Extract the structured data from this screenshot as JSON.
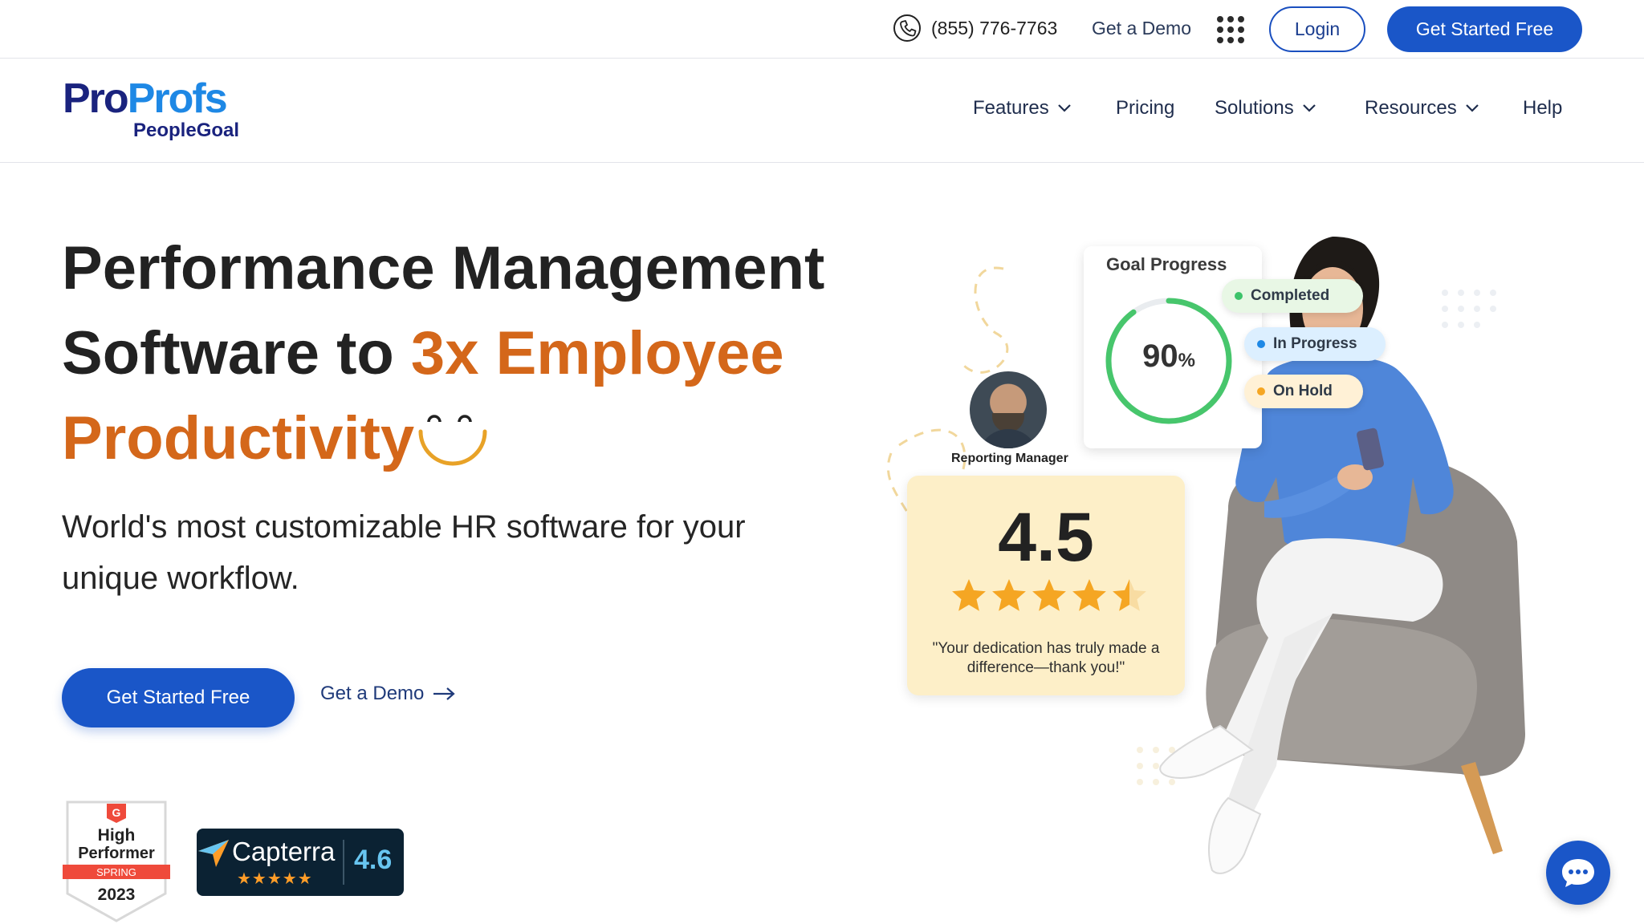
{
  "topbar": {
    "phone": "(855) 776-7763",
    "demo_label": "Get a Demo",
    "login_label": "Login",
    "cta_label": "Get Started Free"
  },
  "logo": {
    "part1": "Pro",
    "part2": "Profs",
    "sub": "PeopleGoal"
  },
  "nav": {
    "features": "Features",
    "pricing": "Pricing",
    "solutions": "Solutions",
    "resources": "Resources",
    "help": "Help"
  },
  "hero": {
    "title_line1": "Performance Management",
    "title_line2_plain": "Software to ",
    "title_line2_accent": "3x Employee",
    "title_line3_accent": "Productivity",
    "subtitle": "World's most customizable HR software for your unique workflow.",
    "cta_label": "Get Started Free",
    "demo_label": "Get a Demo"
  },
  "badges": {
    "g2_line1": "High",
    "g2_line2": "Performer",
    "g2_season": "SPRING",
    "g2_year": "2023",
    "capterra_name": "Capterra",
    "capterra_stars": "★★★★★",
    "capterra_score": "4.6"
  },
  "illustration": {
    "goal_title": "Goal Progress",
    "goal_percent": "90",
    "goal_percent_unit": "%",
    "goal_progress": 0.9,
    "pills": [
      {
        "label": "Completed",
        "dot": "#3cc36a",
        "bg": "#e8f7e5"
      },
      {
        "label": "In Progress",
        "dot": "#1e88e5",
        "bg": "#dcefff"
      },
      {
        "label": "On Hold",
        "dot": "#f5a623",
        "bg": "#fff1d6"
      }
    ],
    "manager_label": "Reporting Manager",
    "rating_value": "4.5",
    "rating_stars": 4.5,
    "rating_quote": "\"Your dedication has truly made a difference—thank you!\""
  },
  "colors": {
    "brand_blue": "#1a56c8",
    "accent_orange": "#d4671a",
    "navy": "#1a237e"
  }
}
